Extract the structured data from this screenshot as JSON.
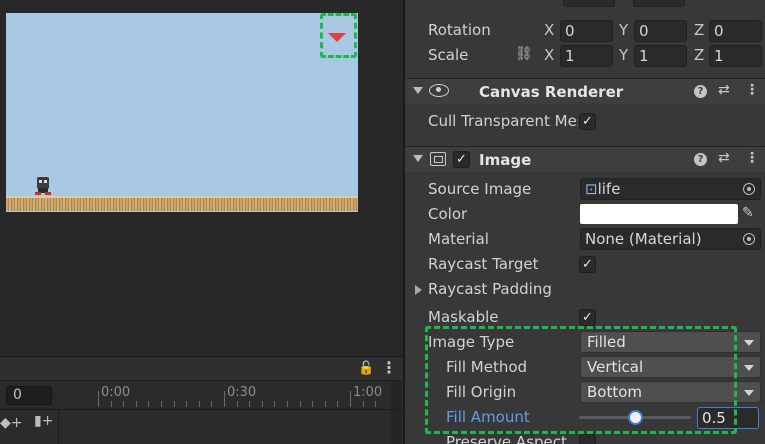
{
  "timeline": {
    "frame_value": "0",
    "ticks": [
      "0:00",
      "0:30",
      "1:00"
    ],
    "more_label": "⋮"
  },
  "transform": {
    "rotation": {
      "label": "Rotation",
      "x": "0",
      "y": "0",
      "z": "0"
    },
    "scale": {
      "label": "Scale",
      "x": "1",
      "y": "1",
      "z": "1"
    },
    "axis": {
      "x": "X",
      "y": "Y",
      "z": "Z"
    }
  },
  "canvas_renderer": {
    "title": "Canvas Renderer",
    "cull_label": "Cull Transparent Mes",
    "cull_checked": true
  },
  "image": {
    "title": "Image",
    "enabled": true,
    "source_image_label": "Source Image",
    "source_image_value": "life",
    "color_label": "Color",
    "color_value": "#ffffff",
    "material_label": "Material",
    "material_value": "None (Material)",
    "raycast_target_label": "Raycast Target",
    "raycast_target": true,
    "raycast_padding_label": "Raycast Padding",
    "maskable_label": "Maskable",
    "maskable": true,
    "image_type_label": "Image Type",
    "image_type_value": "Filled",
    "fill_method_label": "Fill Method",
    "fill_method_value": "Vertical",
    "fill_origin_label": "Fill Origin",
    "fill_origin_value": "Bottom",
    "fill_amount_label": "Fill Amount",
    "fill_amount_value": "0.5",
    "fill_amount": 0.5,
    "preserve_aspect_label": "Preserve Aspect"
  },
  "icons": {
    "check": "✓",
    "help": "?",
    "settings": "⇄",
    "more": "⋮",
    "lock": "🔓",
    "link": "⛓",
    "eyedropper": "✎"
  },
  "colors": {
    "highlight": "#1eb84e",
    "accent_blue": "#5e9eea",
    "scene_sky": "#a8c8e4",
    "life_marker": "#e04040"
  }
}
